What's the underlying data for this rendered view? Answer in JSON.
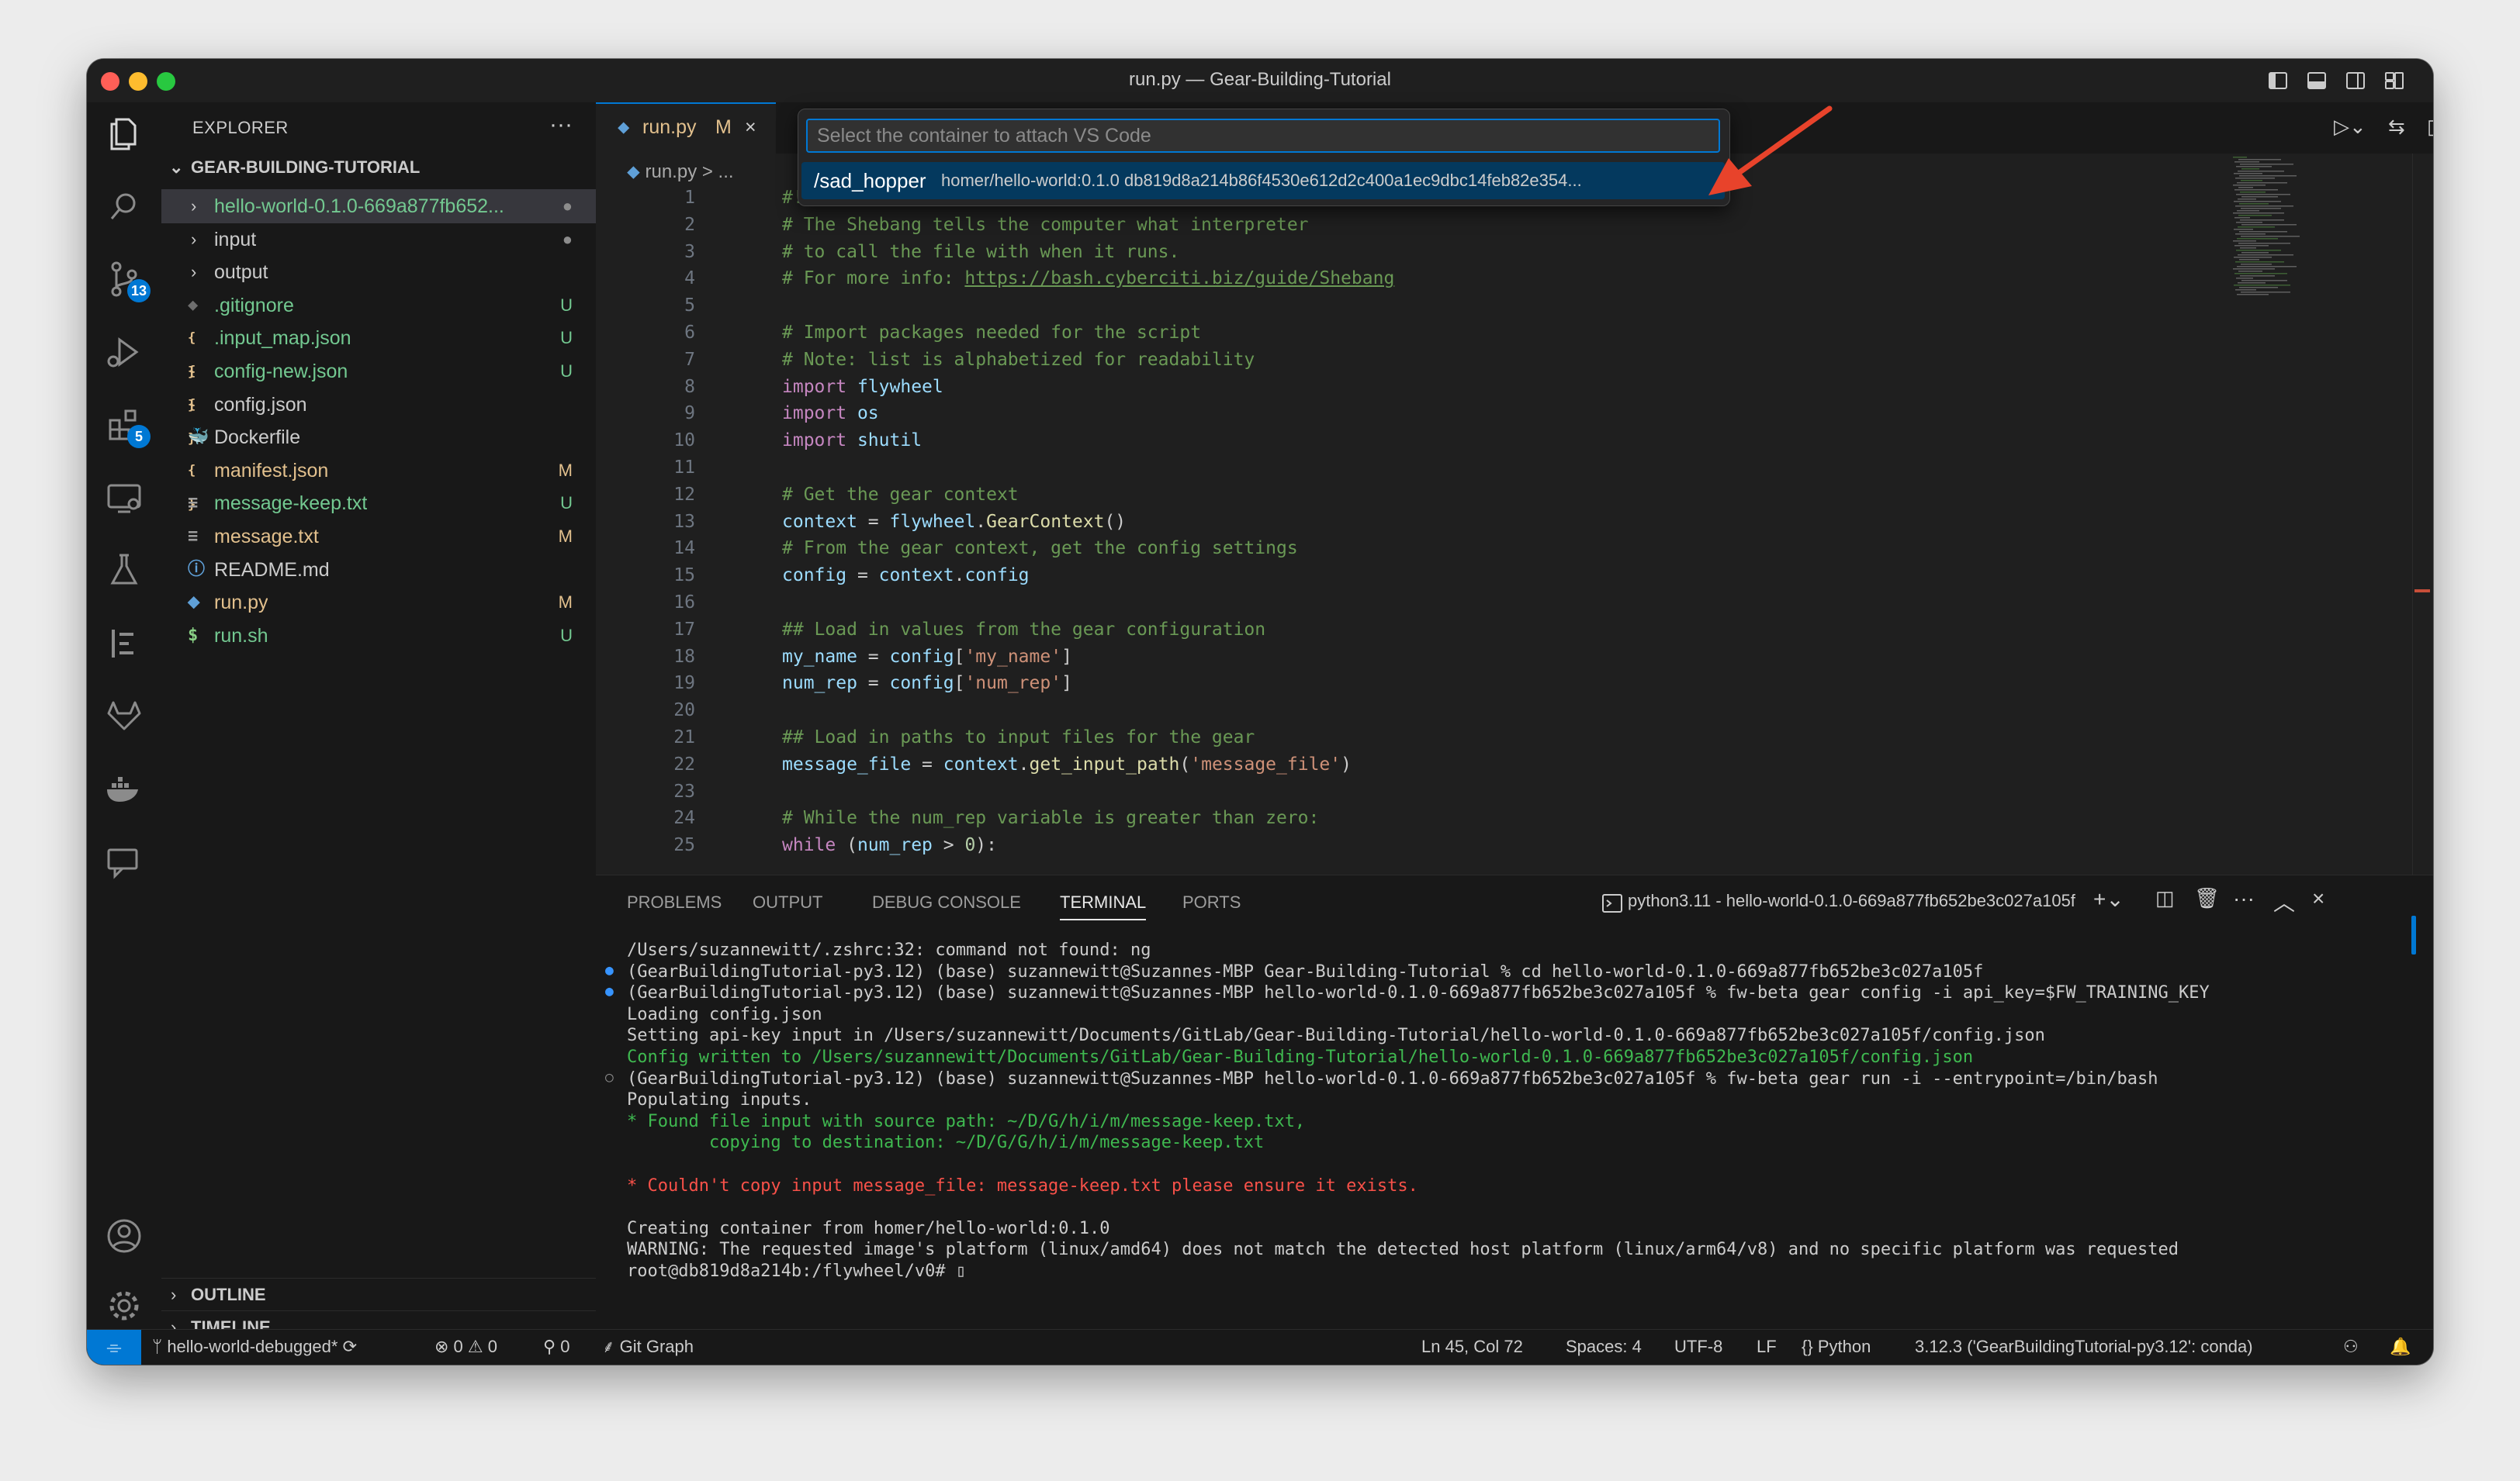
{
  "window": {
    "title": "run.py — Gear-Building-Tutorial"
  },
  "activity_bar": {
    "source_control_badge": "13",
    "extensions_badge": "5"
  },
  "explorer": {
    "title": "EXPLORER",
    "more": "···",
    "root": "GEAR-BUILDING-TUTORIAL",
    "items": [
      {
        "name": "hello-world-0.1.0-669a877fb652...",
        "type": "folder",
        "status": "●",
        "color": "green",
        "selected": true
      },
      {
        "name": "input",
        "type": "folder",
        "status": "●",
        "color": "plain"
      },
      {
        "name": "output",
        "type": "folder",
        "status": "",
        "color": "plain"
      },
      {
        "name": ".gitignore",
        "type": "gitignore",
        "status": "U",
        "color": "green"
      },
      {
        "name": ".input_map.json",
        "type": "json",
        "status": "U",
        "color": "green"
      },
      {
        "name": "config-new.json",
        "type": "json",
        "status": "U",
        "color": "green"
      },
      {
        "name": "config.json",
        "type": "json",
        "status": "",
        "color": "plain"
      },
      {
        "name": "Dockerfile",
        "type": "docker",
        "status": "",
        "color": "plain"
      },
      {
        "name": "manifest.json",
        "type": "json",
        "status": "M",
        "color": "yellow"
      },
      {
        "name": "message-keep.txt",
        "type": "txt",
        "status": "U",
        "color": "green"
      },
      {
        "name": "message.txt",
        "type": "txt",
        "status": "M",
        "color": "yellow"
      },
      {
        "name": "README.md",
        "type": "info",
        "status": "",
        "color": "plain"
      },
      {
        "name": "run.py",
        "type": "python",
        "status": "M",
        "color": "yellow"
      },
      {
        "name": "run.sh",
        "type": "shell",
        "status": "U",
        "color": "green"
      }
    ],
    "outline": "OUTLINE",
    "timeline": "TIMELINE"
  },
  "editor": {
    "tab": {
      "label": "run.py",
      "status": "M"
    },
    "breadcrumb": "run.py > ...",
    "quick_pick": {
      "placeholder": "Select the container to attach VS Code",
      "item_label": "/sad_hopper",
      "item_description": "homer/hello-world:0.1.0 db819d8a214b86f4530e612d2c400a1ec9dbc14feb82e354..."
    },
    "lines": [
      {
        "n": "1",
        "t": "#!/usr/bi"
      },
      {
        "n": "2",
        "t": "# The Shebang tells the computer what interpreter"
      },
      {
        "n": "3",
        "t": "# to call the file with when it runs."
      },
      {
        "n": "4",
        "t": "# For more info: ",
        "link": "https://bash.cyberciti.biz/guide/Shebang"
      },
      {
        "n": "5",
        "t": ""
      },
      {
        "n": "6",
        "t": "# Import packages needed for the script"
      },
      {
        "n": "7",
        "t": "# Note: list is alphabetized for readability"
      },
      {
        "n": "8",
        "t": "import flywheel"
      },
      {
        "n": "9",
        "t": "import os"
      },
      {
        "n": "10",
        "t": "import shutil"
      },
      {
        "n": "11",
        "t": ""
      },
      {
        "n": "12",
        "t": "# Get the gear context"
      },
      {
        "n": "13",
        "t": "context = flywheel.GearContext()"
      },
      {
        "n": "14",
        "t": "# From the gear context, get the config settings"
      },
      {
        "n": "15",
        "t": "config = context.config"
      },
      {
        "n": "16",
        "t": ""
      },
      {
        "n": "17",
        "t": "## Load in values from the gear configuration"
      },
      {
        "n": "18",
        "t": "my_name = config['my_name']"
      },
      {
        "n": "19",
        "t": "num_rep = config['num_rep']"
      },
      {
        "n": "20",
        "t": ""
      },
      {
        "n": "21",
        "t": "## Load in paths to input files for the gear"
      },
      {
        "n": "22",
        "t": "message_file = context.get_input_path('message_file')"
      },
      {
        "n": "23",
        "t": ""
      },
      {
        "n": "24",
        "t": "# While the num_rep variable is greater than zero:"
      },
      {
        "n": "25",
        "t": "while (num_rep > 0):"
      }
    ]
  },
  "panel": {
    "tabs": [
      "PROBLEMS",
      "OUTPUT",
      "DEBUG CONSOLE",
      "TERMINAL",
      "PORTS"
    ],
    "active_tab": "TERMINAL",
    "terminal_name": "python3.11 - hello-world-0.1.0-669a877fb652be3c027a105f",
    "lines": [
      {
        "text": "/Users/suzannewitt/.zshrc:32: command not found: ng",
        "style": "plain",
        "marker": ""
      },
      {
        "text": "(GearBuildingTutorial-py3.12) (base) suzannewitt@Suzannes-MBP Gear-Building-Tutorial % cd hello-world-0.1.0-669a877fb652be3c027a105f",
        "style": "plain",
        "marker": "blue"
      },
      {
        "text": "(GearBuildingTutorial-py3.12) (base) suzannewitt@Suzannes-MBP hello-world-0.1.0-669a877fb652be3c027a105f % fw-beta gear config -i api_key=$FW_TRAINING_KEY",
        "style": "plain",
        "marker": "blue"
      },
      {
        "text": "Loading config.json",
        "style": "plain",
        "marker": ""
      },
      {
        "text": "Setting api-key input in /Users/suzannewitt/Documents/GitLab/Gear-Building-Tutorial/hello-world-0.1.0-669a877fb652be3c027a105f/config.json",
        "style": "plain",
        "marker": ""
      },
      {
        "text": "Config written to /Users/suzannewitt/Documents/GitLab/Gear-Building-Tutorial/hello-world-0.1.0-669a877fb652be3c027a105f/config.json",
        "style": "green",
        "marker": ""
      },
      {
        "text": "(GearBuildingTutorial-py3.12) (base) suzannewitt@Suzannes-MBP hello-world-0.1.0-669a877fb652be3c027a105f % fw-beta gear run -i --entrypoint=/bin/bash",
        "style": "plain",
        "marker": "hollow"
      },
      {
        "text": "Populating inputs.",
        "style": "plain",
        "marker": ""
      },
      {
        "text": "* Found file input with source path: ~/D/G/h/i/m/message-keep.txt,",
        "style": "green",
        "marker": ""
      },
      {
        "text": "        copying to destination: ~/D/G/G/h/i/m/message-keep.txt",
        "style": "green",
        "marker": ""
      },
      {
        "text": "",
        "style": "plain",
        "marker": ""
      },
      {
        "text": "* Couldn't copy input message_file: message-keep.txt please ensure it exists.",
        "style": "red",
        "marker": ""
      },
      {
        "text": "",
        "style": "plain",
        "marker": ""
      },
      {
        "text": "Creating container from homer/hello-world:0.1.0",
        "style": "plain",
        "marker": ""
      },
      {
        "text": "WARNING: The requested image's platform (linux/amd64) does not match the detected host platform (linux/arm64/v8) and no specific platform was requested",
        "style": "plain",
        "marker": ""
      },
      {
        "text": "root@db819d8a214b:/flywheel/v0# ▯",
        "style": "plain",
        "marker": ""
      }
    ]
  },
  "status_bar": {
    "branch": "hello-world-debugged*",
    "errors": "0",
    "warnings": "0",
    "ports": "0",
    "git_graph": "Git Graph",
    "position": "Ln 45, Col 72",
    "spaces": "Spaces: 4",
    "encoding": "UTF-8",
    "eol": "LF",
    "language": "Python",
    "interpreter": "3.12.3 ('GearBuildingTutorial-py3.12': conda)"
  },
  "colors": {
    "accent": "#0078d4",
    "annotation_arrow": "#e8432b",
    "modified": "#e2c08d",
    "untracked": "#73c991"
  }
}
